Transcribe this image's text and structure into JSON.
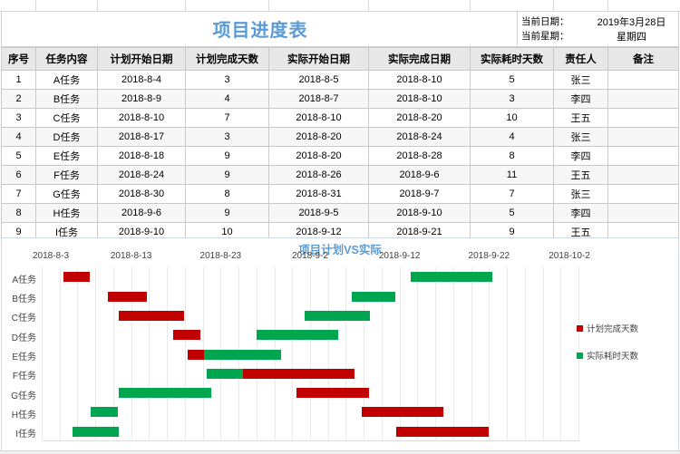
{
  "header": {
    "title": "项目进度表",
    "current_date_label": "当前日期：",
    "current_date_value": "2019年3月28日",
    "current_weekday_label": "当前星期：",
    "current_weekday_value": "星期四"
  },
  "table": {
    "columns": [
      "序号",
      "任务内容",
      "计划开始日期",
      "计划完成天数",
      "实际开始日期",
      "实际完成日期",
      "实际耗时天数",
      "责任人",
      "备注"
    ],
    "rows": [
      {
        "no": "1",
        "task": "A任务",
        "plan_start": "2018-8-4",
        "plan_days": "3",
        "actual_start": "2018-8-5",
        "actual_end": "2018-8-10",
        "actual_days": "5",
        "owner": "张三",
        "remark": ""
      },
      {
        "no": "2",
        "task": "B任务",
        "plan_start": "2018-8-9",
        "plan_days": "4",
        "actual_start": "2018-8-7",
        "actual_end": "2018-8-10",
        "actual_days": "3",
        "owner": "李四",
        "remark": ""
      },
      {
        "no": "3",
        "task": "C任务",
        "plan_start": "2018-8-10",
        "plan_days": "7",
        "actual_start": "2018-8-10",
        "actual_end": "2018-8-20",
        "actual_days": "10",
        "owner": "王五",
        "remark": ""
      },
      {
        "no": "4",
        "task": "D任务",
        "plan_start": "2018-8-17",
        "plan_days": "3",
        "actual_start": "2018-8-20",
        "actual_end": "2018-8-24",
        "actual_days": "4",
        "owner": "张三",
        "remark": ""
      },
      {
        "no": "5",
        "task": "E任务",
        "plan_start": "2018-8-18",
        "plan_days": "9",
        "actual_start": "2018-8-20",
        "actual_end": "2018-8-28",
        "actual_days": "8",
        "owner": "李四",
        "remark": ""
      },
      {
        "no": "6",
        "task": "F任务",
        "plan_start": "2018-8-24",
        "plan_days": "9",
        "actual_start": "2018-8-26",
        "actual_end": "2018-9-6",
        "actual_days": "11",
        "owner": "王五",
        "remark": ""
      },
      {
        "no": "7",
        "task": "G任务",
        "plan_start": "2018-8-30",
        "plan_days": "8",
        "actual_start": "2018-8-31",
        "actual_end": "2018-9-7",
        "actual_days": "7",
        "owner": "张三",
        "remark": ""
      },
      {
        "no": "8",
        "task": "H任务",
        "plan_start": "2018-9-6",
        "plan_days": "9",
        "actual_start": "2018-9-5",
        "actual_end": "2018-9-10",
        "actual_days": "5",
        "owner": "李四",
        "remark": ""
      },
      {
        "no": "9",
        "task": "I任务",
        "plan_start": "2018-9-10",
        "plan_days": "10",
        "actual_start": "2018-9-12",
        "actual_end": "2018-9-21",
        "actual_days": "9",
        "owner": "王五",
        "remark": ""
      }
    ]
  },
  "chart_data": {
    "type": "bar",
    "title": "项目计划VS实际",
    "xlabel": "",
    "ylabel": "",
    "grid": true,
    "legend_position": "right",
    "categories": [
      "A任务",
      "B任务",
      "C任务",
      "D任务",
      "E任务",
      "F任务",
      "G任务",
      "H任务",
      "I任务"
    ],
    "x_tick_labels": [
      "2018-8-3",
      "2018-8-13",
      "2018-8-23",
      "2018-9-2",
      "2018-9-12",
      "2018-9-22",
      "2018-10-2"
    ],
    "x_tick_positions": [
      0.0,
      0.1667,
      0.3333,
      0.5,
      0.6667,
      0.8333,
      1.0
    ],
    "colors": {
      "plan": "#c00000",
      "actual": "#00a550",
      "title": "#5b9bd5"
    },
    "series": [
      {
        "name": "计划完成天数",
        "color": "#c00000",
        "bars": [
          {
            "category": "A任务",
            "start": 0.04,
            "length": 0.049
          },
          {
            "category": "B任务",
            "start": 0.123,
            "length": 0.073
          },
          {
            "category": "C任务",
            "start": 0.143,
            "length": 0.122
          },
          {
            "category": "D任务",
            "start": 0.245,
            "length": 0.051
          },
          {
            "category": "E任务",
            "start": 0.272,
            "length": 0.152
          },
          {
            "category": "F任务",
            "start": 0.37,
            "length": 0.213
          },
          {
            "category": "G任务",
            "start": 0.474,
            "length": 0.135
          },
          {
            "category": "H任务",
            "start": 0.596,
            "length": 0.152
          },
          {
            "category": "I任务",
            "start": 0.661,
            "length": 0.172
          }
        ]
      },
      {
        "name": "实际耗时天数",
        "color": "#00a550",
        "bars": [
          {
            "category": "A任务",
            "start": 0.688,
            "length": 0.152
          },
          {
            "category": "B任务",
            "start": 0.578,
            "length": 0.081
          },
          {
            "category": "C任务",
            "start": 0.49,
            "length": 0.122
          },
          {
            "category": "D任务",
            "start": 0.4,
            "length": 0.152
          },
          {
            "category": "E任务",
            "start": 0.302,
            "length": 0.144
          },
          {
            "category": "F任务",
            "start": 0.307,
            "length": 0.068
          },
          {
            "category": "G任务",
            "start": 0.143,
            "length": 0.172
          },
          {
            "category": "H任务",
            "start": 0.092,
            "length": 0.051
          },
          {
            "category": "I任务",
            "start": 0.058,
            "length": 0.086
          }
        ]
      }
    ]
  }
}
